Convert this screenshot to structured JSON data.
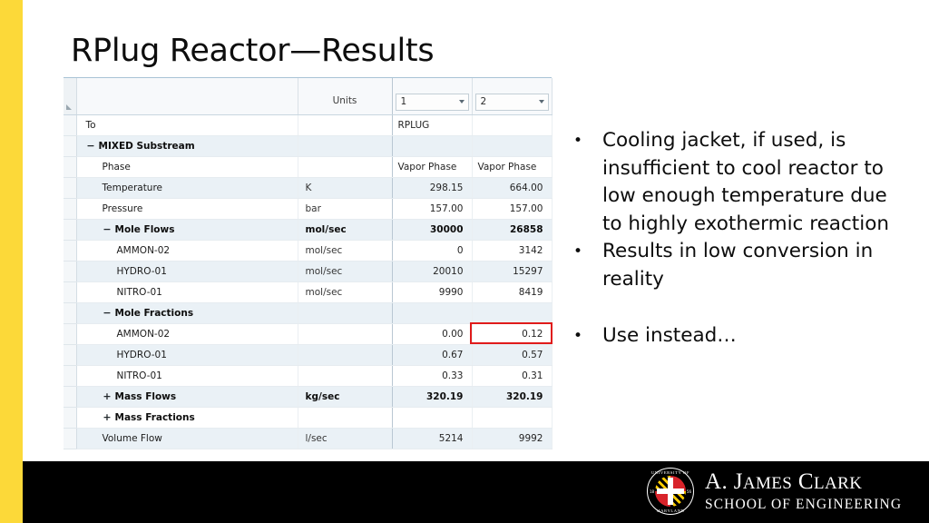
{
  "slide": {
    "title": "RPlug Reactor—Results",
    "accent_yellow": "#FCD939",
    "footer_black": "#000000",
    "highlight_red": "#E01B1B"
  },
  "table": {
    "columns": [
      "",
      "Units",
      "1",
      "2"
    ],
    "header": {
      "units_label": "Units",
      "stream1_label": "1",
      "stream2_label": "2"
    },
    "rows": [
      {
        "indent": 0,
        "icon": "",
        "bold": false,
        "label": "To",
        "units": "",
        "v1": "RPLUG",
        "v2": "",
        "v1_align": "left",
        "v2_align": "left"
      },
      {
        "indent": 0,
        "icon": "−",
        "bold": true,
        "label": "MIXED Substream",
        "units": "",
        "v1": "",
        "v2": ""
      },
      {
        "indent": 1,
        "icon": "",
        "bold": false,
        "label": "Phase",
        "units": "",
        "v1": "Vapor Phase",
        "v2": "Vapor Phase",
        "v1_align": "left",
        "v2_align": "left"
      },
      {
        "indent": 1,
        "icon": "",
        "bold": false,
        "label": "Temperature",
        "units": "K",
        "v1": "298.15",
        "v2": "664.00"
      },
      {
        "indent": 1,
        "icon": "",
        "bold": false,
        "label": "Pressure",
        "units": "bar",
        "v1": "157.00",
        "v2": "157.00"
      },
      {
        "indent": 1,
        "icon": "−",
        "bold": true,
        "label": "Mole Flows",
        "units": "mol/sec",
        "v1": "30000",
        "v2": "26858"
      },
      {
        "indent": 2,
        "icon": "",
        "bold": false,
        "label": "AMMON-02",
        "units": "mol/sec",
        "v1": "0",
        "v2": "3142"
      },
      {
        "indent": 2,
        "icon": "",
        "bold": false,
        "label": "HYDRO-01",
        "units": "mol/sec",
        "v1": "20010",
        "v2": "15297"
      },
      {
        "indent": 2,
        "icon": "",
        "bold": false,
        "label": "NITRO-01",
        "units": "mol/sec",
        "v1": "9990",
        "v2": "8419"
      },
      {
        "indent": 1,
        "icon": "−",
        "bold": true,
        "label": "Mole Fractions",
        "units": "",
        "v1": "",
        "v2": ""
      },
      {
        "indent": 2,
        "icon": "",
        "bold": false,
        "label": "AMMON-02",
        "units": "",
        "v1": "0.00",
        "v2": "0.12",
        "highlight_v2": true
      },
      {
        "indent": 2,
        "icon": "",
        "bold": false,
        "label": "HYDRO-01",
        "units": "",
        "v1": "0.67",
        "v2": "0.57"
      },
      {
        "indent": 2,
        "icon": "",
        "bold": false,
        "label": "NITRO-01",
        "units": "",
        "v1": "0.33",
        "v2": "0.31"
      },
      {
        "indent": 1,
        "icon": "+",
        "bold": true,
        "label": "Mass Flows",
        "units": "kg/sec",
        "v1": "320.19",
        "v2": "320.19"
      },
      {
        "indent": 1,
        "icon": "+",
        "bold": true,
        "label": "Mass Fractions",
        "units": "",
        "v1": "",
        "v2": ""
      },
      {
        "indent": 1,
        "icon": "",
        "bold": false,
        "label": "Volume Flow",
        "units": "l/sec",
        "v1": "5214",
        "v2": "9992"
      }
    ]
  },
  "bullets": [
    {
      "text": "Cooling jacket, if used, is insufficient to cool reactor to low enough temperature due to highly exothermic reaction",
      "spaced": false
    },
    {
      "text": "Results in low conversion in reality",
      "spaced": false
    },
    {
      "text": "Use instead…",
      "spaced": true
    }
  ],
  "bullet_marker": "•",
  "logo": {
    "line1_a": "A. J",
    "line1_b": "AMES",
    "line1_c": " C",
    "line1_d": "LARK",
    "line2": "SCHOOL OF ENGINEERING",
    "seal_top": "UNIVERSITY OF",
    "seal_bottom": "MARYLAND",
    "seal_year_left": "18",
    "seal_year_right": "56"
  }
}
